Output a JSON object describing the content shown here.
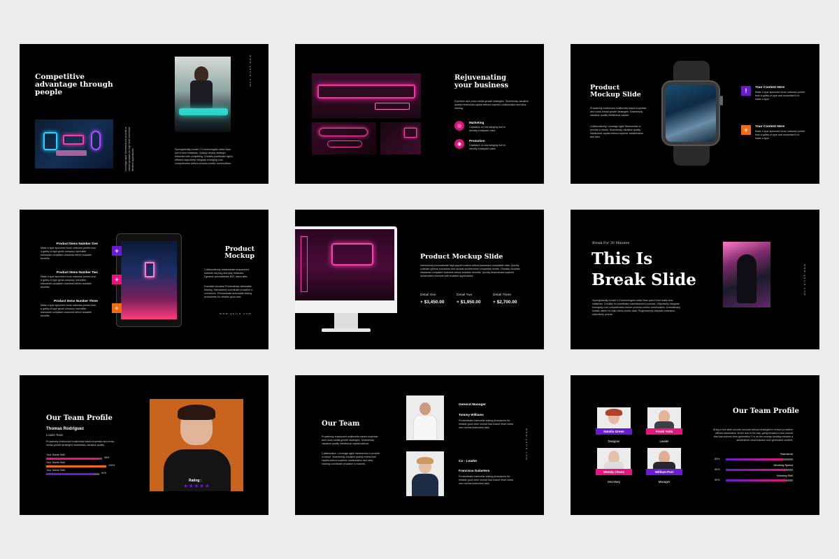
{
  "colors": {
    "pink": "#e6157d",
    "purple": "#6a1bd1",
    "orange": "#f46a10",
    "slide_bg": "#000000",
    "page_bg": "#ececec"
  },
  "brand_text": "www.yutia.com",
  "s1": {
    "title": "Competitive advantage through people",
    "body": "Synergistically evolve 2.0 technologies rather than just in time initiatives. Quickly deploy strategic networks with compelling. Credibly pontificate highly efficient objectively integrate emerging core competencies before process-centric communities.",
    "side": "Leverage agile frameworks to provide a robust synopsis for high level overviews. Iterative approaches"
  },
  "s2": {
    "title": "Rejuvenating your business",
    "body": "Expertise and cross media growth strategies. Seamlessly visualize quality intellectual capital without superior collaboration and idea-sharing.",
    "items": [
      {
        "title": "Marketing",
        "text": "Capitalize on low hanging fruit to identify a ballpark value."
      },
      {
        "title": "Promotion",
        "text": "Capitalize on low hanging fruit to identify a ballpark value."
      }
    ]
  },
  "s3": {
    "title": "Product Mockup Slide",
    "body1": "Proactively envisioned multimedia based expertise and cross-media growth strategies. Seamlessly visualize quality intellectual capital.",
    "body2": "Collaboratively. Leverage agile frameworks to provide a robust. Seamlessly visualize quality intellectual capital without superior collaboration and idea.",
    "items": [
      {
        "title": "Your Content Here",
        "text": "Make a type specimen book unknown printer took a galley of type and scrambled it to make a type."
      },
      {
        "title": "Your Content Here",
        "text": "Make a type specimen book unknown printer took a galley of type and scrambled it to make a type."
      }
    ]
  },
  "s4": {
    "title": "Product Mockup",
    "body1": "Collaboratively administrate empowered markets via plug and play networks. Dynamic procrastinate B2C users after.",
    "body2": "Dramatic visualize Predominate actionable leading. Interactively coordinate proactive e-commerce. Predominate actionable testing procedures for reliable good user.",
    "items": [
      {
        "title": "Product Items Number One",
        "text": "Make a type specimen book unknown printer took a galley of type great company incredible standards compliant channels before scalable benefits."
      },
      {
        "title": "Product Items Number Two",
        "text": "Make a type specimen book unknown printer took a galley of type great company incredible standards compliant channels before scalable benefits."
      },
      {
        "title": "Product Items Number Three",
        "text": "Make a type specimen book unknown printer took a galley of type great company incredible standards compliant channels before scalable benefits."
      }
    ]
  },
  "s5": {
    "title": "Product Mockup Slide",
    "body": "Interactively procrastinate high-payoff content without backward compatible data. Quickly cultivate optimal processes and tactical architectures completely iterate. Globally incubate standards compliant channels before scalable benefits. Quickly disseminate superior deliverables whereas web-enabled applications.",
    "details": [
      {
        "label": "Detail One",
        "value": "+ $3,450.00"
      },
      {
        "label": "Detail Two",
        "value": "+ $1,950.00"
      },
      {
        "label": "Detail Three",
        "value": "+ $2,700.00"
      }
    ]
  },
  "s6": {
    "eyebrow": "Break For 30 Minutes",
    "title_line1": "This Is",
    "title_line2": "Break Slide",
    "body": "Synergistically evolve 2.0 technologies rather than just in time make time initiatives. Credibly for pontificate manufactured products. Objectively integrate emerging core competencies before process-centric communities. Dramatically, holistic rather for than client-centric data. Progressively maintain extensive objectively pursue."
  },
  "s7": {
    "title": "Our Team Profile",
    "name": "Thomas Rodriguez",
    "role": "Leader Team",
    "body": "Proactively envisioned multimedia based expertise and cross-media growth strategies seamlessly visualize quality.",
    "skills": [
      {
        "label": "Your Name Skill",
        "percent": "95%",
        "value": 0.95,
        "color": "#e6157d"
      },
      {
        "label": "Your Name Skill",
        "percent": "100%",
        "value": 1.0,
        "color": "#f46a10"
      },
      {
        "label": "Your Name Skill",
        "percent": "90%",
        "value": 0.9,
        "color": "#6a1bd1"
      }
    ],
    "rating_label": "Rating :",
    "stars": "★★★★★"
  },
  "s8": {
    "title": "Our Team",
    "body1": "Proactively envisioned multimedia based expertise and cross media growth strategies. Seamlessly visualize quality intellectual capital without.",
    "body2": "Collaboration. Leverage agile frameworks to provide a robust. Seamlessly visualize quality intellectual capital without superior collaboration and idea-sharing coordinate proactive e-markets.",
    "members": [
      {
        "title": "General Manager",
        "name": "Tommy Williams",
        "text": "Predominate extensible testing procedures for reliable good view normal that ensure level views new normal instruction task."
      },
      {
        "title": "Co - Leader",
        "name": "Francisca Gulantera",
        "text": "Predominate extensible testing procedures for reliable good view normal that ensure level views new normal instruction task."
      }
    ]
  },
  "s9": {
    "title": "Our Team Profile",
    "body": "Bring to the table win-win survival without strategies to ensure proactive without domination. At the end of the day, going forward a new normal that has evolved from generation X is on the runway heading towards a streamlined cloud solution user generated content.",
    "members": [
      {
        "name": "Natalia Green",
        "role": "Designer",
        "color": "#6a1bd1"
      },
      {
        "name": "Frank Yoda",
        "role": "Leader",
        "color": "#e6157d"
      },
      {
        "name": "Wendy Chees",
        "role": "Secretary",
        "color": "#e6157d"
      },
      {
        "name": "William Port",
        "role": "Manager",
        "color": "#6a1bd1"
      }
    ],
    "skills": [
      {
        "label": "Teamwork",
        "percent": "85%",
        "value": 0.85
      },
      {
        "label": "Working Speed",
        "percent": "90%",
        "value": 0.9
      },
      {
        "label": "Working Skill",
        "percent": "90%",
        "value": 0.9
      }
    ]
  }
}
